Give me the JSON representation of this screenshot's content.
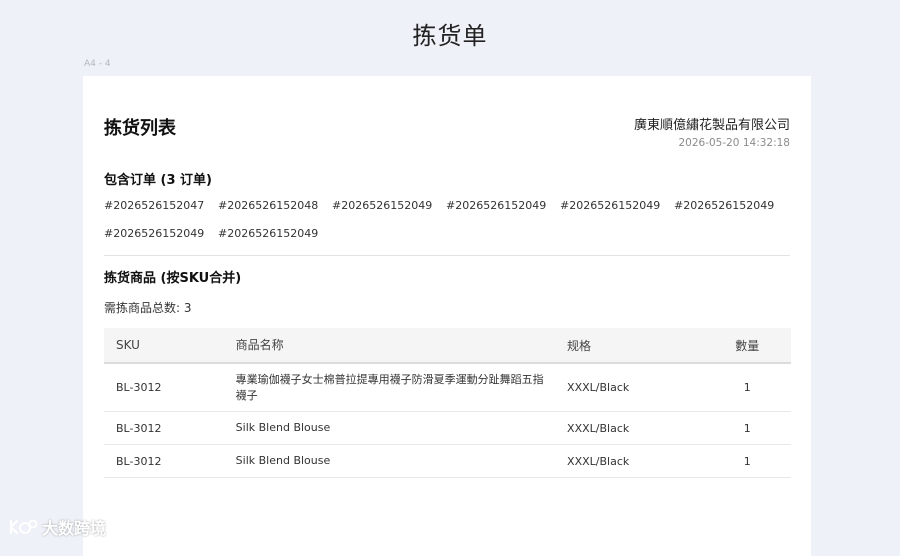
{
  "window": {
    "title": "拣货单",
    "paper_size": "A4 - 4"
  },
  "sheet": {
    "title": "拣货列表",
    "company": "廣東順億繡花製品有限公司",
    "datetime": "2026-05-20 14:32:18"
  },
  "orders": {
    "title": "包含订单 (3 订单)",
    "ids": [
      "#2026526152047",
      "#2026526152048",
      "#2026526152049",
      "#2026526152049",
      "#2026526152049",
      "#2026526152049",
      "#2026526152049",
      "#2026526152049"
    ]
  },
  "items": {
    "title": "拣货商品 (按SKU合并)",
    "total_label": "需拣商品总数: 3",
    "columns": {
      "sku": "SKU",
      "name": "商品名称",
      "spec": "规格",
      "qty": "數量"
    },
    "rows": [
      {
        "sku": "BL-3012",
        "name": "專業瑜伽襪子女士棉普拉提專用襪子防滑夏季運動分趾舞蹈五指襪子",
        "spec": "XXXL/Black",
        "qty": "1"
      },
      {
        "sku": "BL-3012",
        "name": "Silk Blend Blouse",
        "spec": "XXXL/Black",
        "qty": "1"
      },
      {
        "sku": "BL-3012",
        "name": "Silk Blend Blouse",
        "spec": "XXXL/Black",
        "qty": "1"
      }
    ]
  },
  "watermark": {
    "text": "大数跨境",
    "icon": "brand-logo-icon"
  }
}
